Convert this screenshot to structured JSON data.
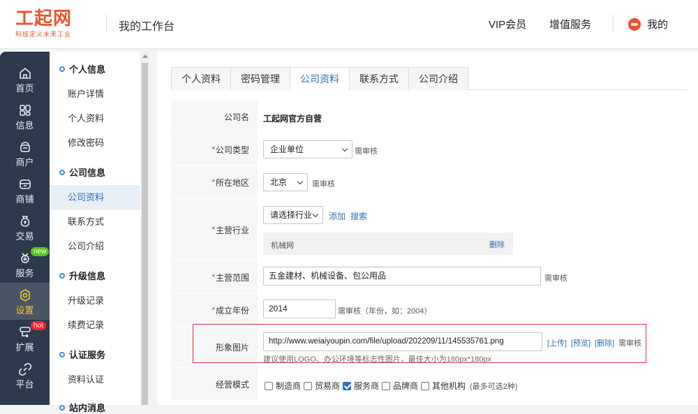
{
  "header": {
    "logo_main": "工起网",
    "logo_sub": "科技定义未来工业",
    "workspace_title": "我的工作台",
    "nav_vip": "VIP会员",
    "nav_services": "增值服务",
    "nav_me": "我的"
  },
  "leftnav": {
    "items": [
      {
        "label": "首页",
        "icon": "home-icon"
      },
      {
        "label": "信息",
        "icon": "grid-icon"
      },
      {
        "label": "商户",
        "icon": "merchant-icon"
      },
      {
        "label": "商铺",
        "icon": "shop-icon"
      },
      {
        "label": "交易",
        "icon": "trade-icon"
      },
      {
        "label": "服务",
        "icon": "service-icon",
        "badge": "new"
      },
      {
        "label": "设置",
        "icon": "settings-icon",
        "active": true
      },
      {
        "label": "扩展",
        "icon": "extend-icon",
        "badge": "hot"
      },
      {
        "label": "平台",
        "icon": "link-icon"
      }
    ]
  },
  "submenu": {
    "group1": "个人信息",
    "g1_items": [
      "账户详情",
      "个人资料",
      "修改密码"
    ],
    "group2": "公司信息",
    "g2_items": [
      "公司资料",
      "联系方式",
      "公司介绍"
    ],
    "group3": "升级信息",
    "g3_items": [
      "升级记录",
      "续费记录"
    ],
    "group4": "认证服务",
    "g4_items": [
      "资料认证"
    ],
    "group5": "站内消息"
  },
  "tabs": [
    "个人资料",
    "密码管理",
    "公司资料",
    "联系方式",
    "公司介绍"
  ],
  "form": {
    "company_name_label": "公司名",
    "company_name": "工起网官方自营",
    "company_type_label": "公司类型",
    "company_type": "企业单位",
    "needs_review": "需审核",
    "region_label": "所在地区",
    "region": "北京",
    "industry_label": "主营行业",
    "industry_select": "请选择行业",
    "add": "添加",
    "search": "搜索",
    "industry_item": "机械网",
    "delete": "删除",
    "scope_label": "主营范围",
    "scope": "五金建材、机械设备、包公用品",
    "year_label": "成立年份",
    "year": "2014",
    "year_hint": "需审核（年份，如：2004）",
    "image_label": "形象图片",
    "image_url": "http://www.weiaiyoupin.com/file/upload/202209/11/145535761.png",
    "upload": "[上传]",
    "preview": "[预览]",
    "remove": "[删除]",
    "image_hint": "建议使用LOGO、办公环境等标志性图片，最佳大小为180px*180px",
    "mode_label": "经营模式",
    "modes": [
      {
        "label": "制造商",
        "checked": false
      },
      {
        "label": "贸易商",
        "checked": false
      },
      {
        "label": "服务商",
        "checked": true
      },
      {
        "label": "品牌商",
        "checked": false
      },
      {
        "label": "其他机构",
        "checked": false
      }
    ],
    "mode_hint": "(最多可选2种)"
  },
  "colors": {
    "brand": "#e8532f",
    "sidebar": "#2c3a4c",
    "active_nav": "#f0c232",
    "link": "#2f6fbe",
    "highlight_border": "#d9363e"
  }
}
